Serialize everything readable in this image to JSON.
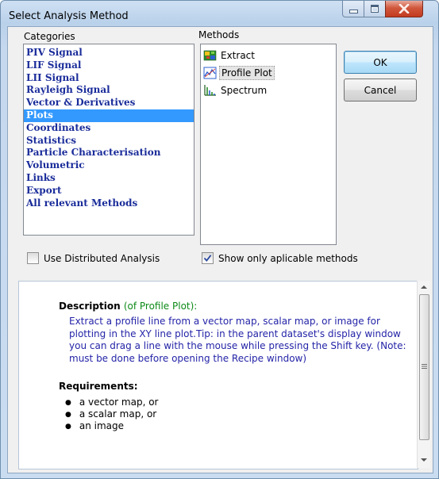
{
  "window": {
    "title": "Select Analysis Method",
    "controls": [
      "minimize",
      "maximize",
      "close"
    ]
  },
  "categories": {
    "label": "Categories",
    "items": [
      "PIV Signal",
      "LIF Signal",
      "LII Signal",
      "Rayleigh Signal",
      "Vector & Derivatives",
      "Plots",
      "Coordinates",
      "Statistics",
      "Particle Characterisation",
      "Volumetric",
      "Links",
      "Export",
      "All relevant Methods"
    ],
    "selected": "Plots"
  },
  "methods": {
    "label": "Methods",
    "items": [
      {
        "label": "Extract",
        "icon": "extract-icon"
      },
      {
        "label": "Profile Plot",
        "icon": "profile-plot-icon"
      },
      {
        "label": "Spectrum",
        "icon": "spectrum-icon"
      }
    ],
    "selected": "Profile Plot"
  },
  "buttons": {
    "ok": "OK",
    "cancel": "Cancel"
  },
  "options": {
    "distributed": {
      "label": "Use Distributed Analysis",
      "checked": false
    },
    "applicable": {
      "label": "Show only aplicable methods",
      "checked": true
    }
  },
  "description": {
    "heading": "Description",
    "subheading": "(of Profile Plot):",
    "text": "Extract a profile line from a vector map, scalar map, or image for plotting in the XY line plot.Tip: in the parent dataset's display window you can drag a line with the mouse while pressing the Shift key. (Note: must be done before opening the Recipe window)",
    "requirements_heading": "Requirements:",
    "requirements": [
      "a vector map, or",
      "a scalar map, or",
      "an image"
    ]
  },
  "colors": {
    "category_text": "#1a2c9a",
    "selection": "#3399ff",
    "description_text": "#2424a8",
    "description_subheading": "#0d8a17"
  }
}
